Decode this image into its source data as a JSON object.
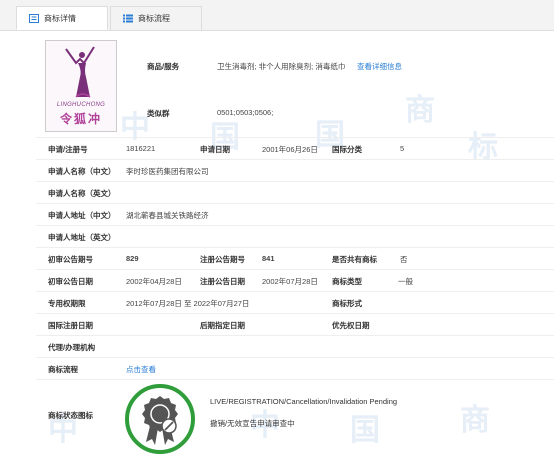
{
  "tabs": [
    {
      "label": "商标详情",
      "icon": "document-icon",
      "active": true
    },
    {
      "label": "商标流程",
      "icon": "list-icon",
      "active": false
    }
  ],
  "logo": {
    "text_en": "LINGHUCHONG",
    "text_cn": "令狐冲"
  },
  "goods_services": {
    "label": "商品/服务",
    "value": "卫生消毒剂; 非个人用除臭剂; 消毒纸巾",
    "link": "查看详细信息"
  },
  "similar_group": {
    "label": "类似群",
    "value": "0501;0503;0506;"
  },
  "fields": {
    "reg_no_label": "申请/注册号",
    "reg_no": "1816221",
    "app_date_label": "申请日期",
    "app_date": "2001年06月26日",
    "intl_class_label": "国际分类",
    "intl_class": "5",
    "applicant_cn_label": "申请人名称（中文）",
    "applicant_cn": "李时珍医药集团有限公司",
    "applicant_en_label": "申请人名称（英文）",
    "address_cn_label": "申请人地址（中文）",
    "address_cn": "湖北蕲春县城关铁路经济",
    "address_en_label": "申请人地址（英文）",
    "prelim_pub_no_label": "初审公告期号",
    "prelim_pub_no": "829",
    "reg_pub_no_label": "注册公告期号",
    "reg_pub_no": "841",
    "shared_label": "是否共有商标",
    "shared": "否",
    "prelim_pub_date_label": "初审公告日期",
    "prelim_pub_date": "2002年04月28日",
    "reg_pub_date_label": "注册公告日期",
    "reg_pub_date": "2002年07月28日",
    "tm_type_label": "商标类型",
    "tm_type": "一般",
    "exclusive_period_label": "专用权期限",
    "exclusive_period": "2012年07月28日 至 2022年07月27日",
    "tm_form_label": "商标形式",
    "intl_reg_date_label": "国际注册日期",
    "later_designation_label": "后期指定日期",
    "priority_date_label": "优先权日期",
    "agent_label": "代理/办理机构",
    "process_label": "商标流程",
    "process_link": "点击查看",
    "status_label": "商标状态图标"
  },
  "status": {
    "en": "LIVE/REGISTRATION/Cancellation/Invalidation Pending",
    "cn": "撤销/无效宣告申请审查中",
    "icon": "award-badge-icon",
    "color": "#2f9e3a"
  },
  "colors": {
    "link": "#2a7ed6",
    "accent": "#2f9e3a",
    "tab_bg": "#f3f3f3"
  }
}
